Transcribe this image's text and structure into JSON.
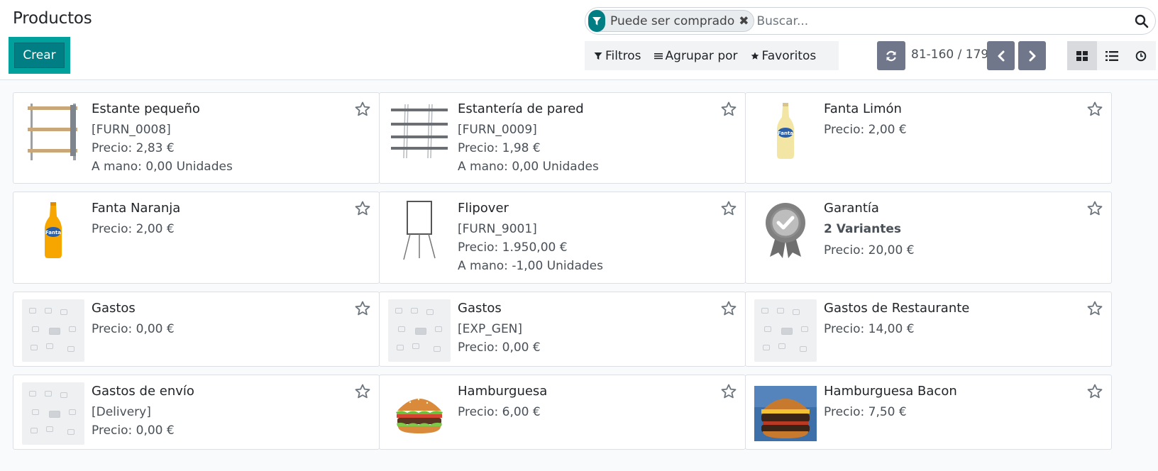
{
  "header": {
    "title": "Productos",
    "create_label": "Crear"
  },
  "search": {
    "facet_label": "Puede ser comprado",
    "facet_remove": "✖",
    "placeholder": "Buscar..."
  },
  "filters": {
    "filters_label": "Filtros",
    "group_label": "Agrupar por",
    "favorites_label": "Favoritos"
  },
  "pager": {
    "value": "81-160 / 179"
  },
  "views": [
    "kanban",
    "list",
    "activity"
  ],
  "colors": {
    "accent": "#017e84",
    "highlight": "#00a09d",
    "pager_button": "#71778a"
  },
  "products": [
    {
      "name": "Estante pequeño",
      "code": "[FURN_0008]",
      "price": "Precio: 2,83 €",
      "onhand": "A mano: 0,00 Unidades",
      "image": "shelf-image"
    },
    {
      "name": "Estantería de pared",
      "code": "[FURN_0009]",
      "price": "Precio: 1,98 €",
      "onhand": "A mano: 0,00 Unidades",
      "image": "wall-shelf-image"
    },
    {
      "name": "Fanta Limón",
      "price": "Precio: 2,00 €",
      "image": "lemon-soda-image"
    },
    {
      "name": "Fanta Naranja",
      "price": "Precio: 2,00 €",
      "image": "orange-soda-image"
    },
    {
      "name": "Flipover",
      "code": "[FURN_9001]",
      "price": "Precio: 1.950,00 €",
      "onhand": "A mano: -1,00 Unidades",
      "image": "flipchart-image"
    },
    {
      "name": "Garantía",
      "variants": "2 Variantes",
      "price": "Precio: 20,00 €",
      "image": "badge-image"
    },
    {
      "name": "Gastos",
      "price": "Precio: 0,00 €",
      "image": "placeholder-image"
    },
    {
      "name": "Gastos",
      "code": "[EXP_GEN]",
      "price": "Precio: 0,00 €",
      "image": "placeholder-image"
    },
    {
      "name": "Gastos de Restaurante",
      "price": "Precio: 14,00 €",
      "image": "placeholder-image"
    },
    {
      "name": "Gastos de envío",
      "code": "[Delivery]",
      "price": "Precio: 0,00 €",
      "image": "placeholder-image"
    },
    {
      "name": "Hamburguesa",
      "price": "Precio: 6,00 €",
      "image": "burger-image"
    },
    {
      "name": "Hamburguesa Bacon",
      "price": "Precio: 7,50 €",
      "image": "bacon-burger-image"
    }
  ]
}
